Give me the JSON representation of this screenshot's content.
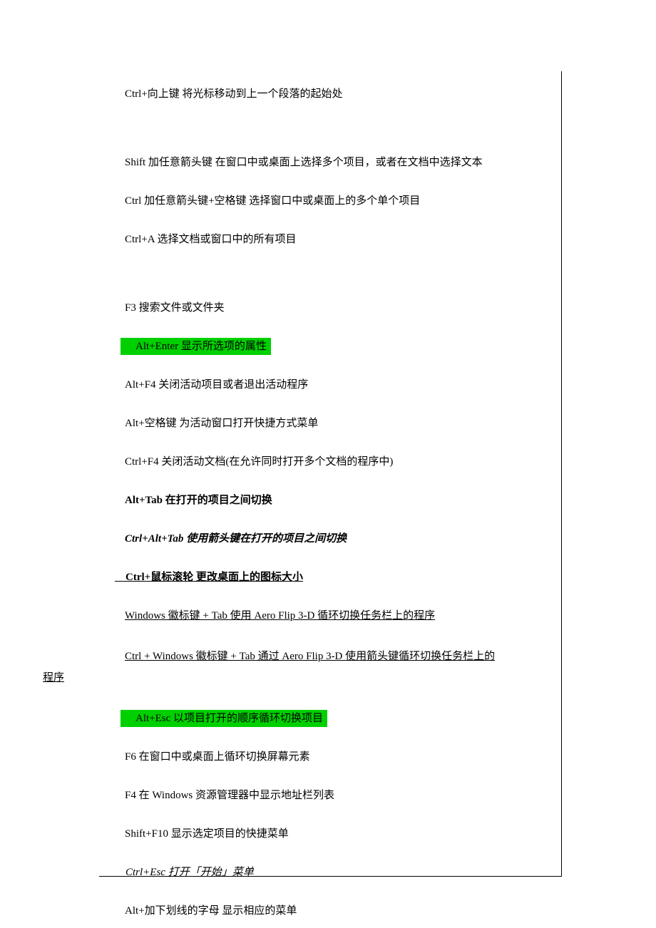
{
  "lines": {
    "l1": "Ctrl+向上键  将光标移动到上一个段落的起始处",
    "l2": "Shift  加任意箭头键  在窗口中或桌面上选择多个项目，或者在文档中选择文本",
    "l3": "Ctrl  加任意箭头键+空格键  选择窗口中或桌面上的多个单个项目",
    "l4": "Ctrl+A  选择文档或窗口中的所有项目",
    "l5": "F3  搜索文件或文件夹",
    "l6": "　Alt+Enter  显示所选项的属性",
    "l7": "Alt+F4  关闭活动项目或者退出活动程序",
    "l8": "Alt+空格键  为活动窗口打开快捷方式菜单",
    "l9": "Ctrl+F4  关闭活动文档(在允许同时打开多个文档的程序中)",
    "l10": "Alt+Tab  在打开的项目之间切换",
    "l11": "Ctrl+Alt+Tab  使用箭头键在打开的项目之间切换",
    "l12": "　Ctrl+鼠标滚轮  更改桌面上的图标大小",
    "l13": "Windows  徽标键  + Tab  使用  Aero Flip 3-D  循环切换任务栏上的程序",
    "l14a": "Ctrl + Windows  徽标键  + Tab  通过  Aero Flip 3-D  使用箭头键循环切换任务栏上的",
    "l14b": "程序",
    "l15": "　Alt+Esc  以项目打开的顺序循环切换项目",
    "l16": "F6  在窗口中或桌面上循环切换屏幕元素",
    "l17": "F4  在  Windows  资源管理器中显示地址栏列表",
    "l18": "Shift+F10  显示选定项目的快捷菜单",
    "l19": "　Ctrl+Esc  打开「开始」菜单",
    "l20": "Alt+加下划线的字母  显示相应的菜单"
  }
}
